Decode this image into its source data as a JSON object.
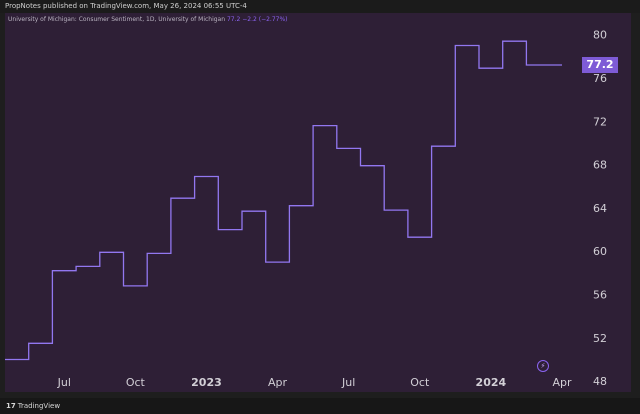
{
  "header": {
    "published_by": "PropNotes published on TradingView.com, May 26, 2024 06:55 UTC-4"
  },
  "legend": {
    "symbol": "University of Michigan: Consumer Sentiment, 1D, University of Michigan",
    "last": "77.2",
    "change": "−2.2 (−2.77%)"
  },
  "price_tag": "77.2",
  "footer": {
    "brand": "TradingView",
    "logo_icon": "tradingview-logo-icon"
  },
  "colors": {
    "line": "#9277f0",
    "panel": "#2e1f36",
    "tag": "#7e5bd6"
  },
  "chart_data": {
    "type": "line",
    "step": true,
    "x": [
      "2022-05",
      "2022-06",
      "2022-07",
      "2022-08",
      "2022-09",
      "2022-10",
      "2022-11",
      "2022-12",
      "2023-01",
      "2023-02",
      "2023-03",
      "2023-04",
      "2023-05",
      "2023-06",
      "2023-07",
      "2023-08",
      "2023-09",
      "2023-10",
      "2023-11",
      "2023-12",
      "2024-01",
      "2024-02",
      "2024-03",
      "2024-04"
    ],
    "series": [
      {
        "values": [
          50.0,
          51.5,
          58.2,
          58.6,
          59.9,
          56.8,
          59.8,
          64.9,
          66.9,
          62.0,
          63.7,
          59.0,
          64.2,
          71.6,
          69.5,
          67.9,
          63.8,
          61.3,
          69.7,
          79.0,
          76.9,
          79.4,
          77.2,
          77.2
        ]
      }
    ],
    "ylim": [
      47,
      82
    ],
    "y_ticks": [
      48,
      52,
      56,
      60,
      64,
      68,
      72,
      76,
      80
    ],
    "x_ticks": [
      {
        "x": "2022-07",
        "label": "Jul"
      },
      {
        "x": "2022-10",
        "label": "Oct"
      },
      {
        "x": "2023-01",
        "label": "2023",
        "major": true
      },
      {
        "x": "2023-04",
        "label": "Apr"
      },
      {
        "x": "2023-07",
        "label": "Jul"
      },
      {
        "x": "2023-10",
        "label": "Oct"
      },
      {
        "x": "2024-01",
        "label": "2024",
        "major": true
      },
      {
        "x": "2024-04",
        "label": "Apr"
      }
    ],
    "last_value": 77.2,
    "grid": false
  }
}
